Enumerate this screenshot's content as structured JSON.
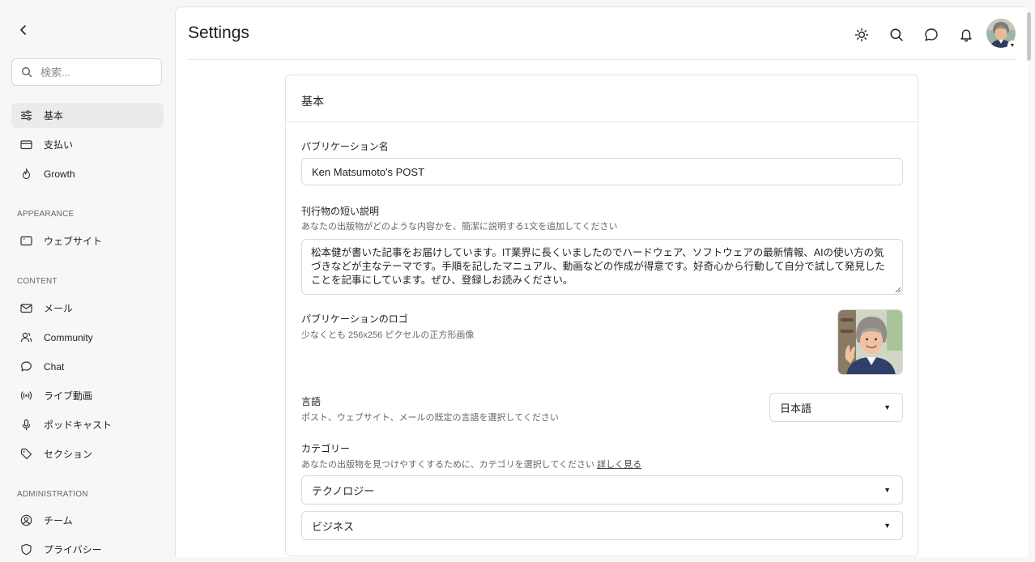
{
  "sidebar": {
    "search_placeholder": "検索...",
    "items_top": [
      {
        "label": "基本",
        "icon": "sliders-icon",
        "active": true
      },
      {
        "label": "支払い",
        "icon": "credit-card-icon"
      },
      {
        "label": "Growth",
        "icon": "flame-icon"
      }
    ],
    "appearance_label": "APPEARANCE",
    "appearance_items": [
      {
        "label": "ウェブサイト",
        "icon": "browser-window-icon"
      }
    ],
    "content_label": "CONTENT",
    "content_items": [
      {
        "label": "メール",
        "icon": "mail-icon"
      },
      {
        "label": "Community",
        "icon": "users-icon"
      },
      {
        "label": "Chat",
        "icon": "chat-bubble-icon"
      },
      {
        "label": "ライブ動画",
        "icon": "broadcast-icon"
      },
      {
        "label": "ポッドキャスト",
        "icon": "microphone-icon"
      },
      {
        "label": "セクション",
        "icon": "tag-icon"
      }
    ],
    "admin_label": "ADMINISTRATION",
    "admin_items": [
      {
        "label": "チーム",
        "icon": "user-circle-icon"
      },
      {
        "label": "プライバシー",
        "icon": "shield-icon"
      }
    ]
  },
  "header": {
    "title": "Settings"
  },
  "card": {
    "title": "基本",
    "publication_name": {
      "label": "パブリケーション名",
      "value": "Ken Matsumoto's POST"
    },
    "description": {
      "label": "刊行物の短い説明",
      "help": "あなたの出版物がどのような内容かを、簡潔に説明する1文を追加してください",
      "value": "松本健が書いた記事をお届けしています。IT業界に長くいましたのでハードウェア、ソフトウェアの最新情報、AIの使い方の気づきなどが主なテーマです。手順を記したマニュアル、動画などの作成が得意です。好奇心から行動して自分で試して発見したことを記事にしています。ぜひ、登録しお読みください。"
    },
    "logo": {
      "label": "パブリケーションのロゴ",
      "help": "少なくとも 256x256 ピクセルの正方形画像"
    },
    "language": {
      "label": "言語",
      "help": "ポスト、ウェブサイト、メールの既定の言語を選択してください",
      "value": "日本語"
    },
    "category": {
      "label": "カテゴリー",
      "help": "あなたの出版物を見つけやすくするために、カテゴリを選択してください",
      "link": "詳しく見る",
      "primary": "テクノロジー",
      "secondary": "ビジネス"
    }
  }
}
